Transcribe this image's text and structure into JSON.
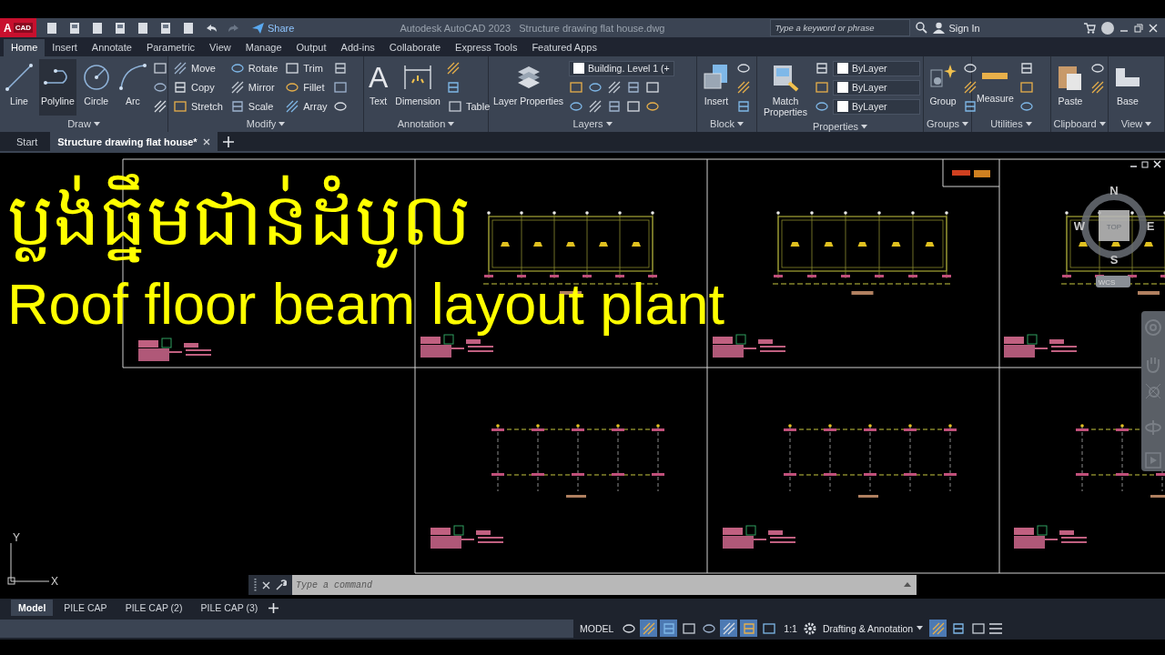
{
  "title_bar": {
    "logo_main": "A",
    "logo_sub": "CAD",
    "share": "Share",
    "app_title": "Autodesk AutoCAD 2023",
    "file_name": "Structure drawing flat house.dwg",
    "search_placeholder": "Type a keyword or phrase",
    "sign_in": "Sign In"
  },
  "ribbon_tabs": [
    {
      "label": "Home",
      "selected": true
    },
    {
      "label": "Insert",
      "selected": false
    },
    {
      "label": "Annotate",
      "selected": false
    },
    {
      "label": "Parametric",
      "selected": false
    },
    {
      "label": "View",
      "selected": false
    },
    {
      "label": "Manage",
      "selected": false
    },
    {
      "label": "Output",
      "selected": false
    },
    {
      "label": "Add-ins",
      "selected": false
    },
    {
      "label": "Collaborate",
      "selected": false
    },
    {
      "label": "Express Tools",
      "selected": false
    },
    {
      "label": "Featured Apps",
      "selected": false
    }
  ],
  "panels": [
    {
      "title": "Draw",
      "items": [
        {
          "kind": "large",
          "label": "Line",
          "highlighted": false
        },
        {
          "kind": "large",
          "label": "Polyline",
          "highlighted": true
        },
        {
          "kind": "large",
          "label": "Circle",
          "highlighted": false
        },
        {
          "kind": "large",
          "label": "Arc",
          "highlighted": false
        },
        {
          "kind": "icon"
        },
        {
          "kind": "icon"
        },
        {
          "kind": "icon"
        }
      ]
    },
    {
      "title": "Modify",
      "items": [
        {
          "kind": "small",
          "label": "Move"
        },
        {
          "kind": "small",
          "label": "Copy"
        },
        {
          "kind": "small",
          "label": "Stretch"
        },
        {
          "kind": "small",
          "label": "Rotate"
        },
        {
          "kind": "small",
          "label": "Mirror"
        },
        {
          "kind": "small",
          "label": "Scale"
        },
        {
          "kind": "small",
          "label": "Trim"
        },
        {
          "kind": "small",
          "label": "Fillet"
        },
        {
          "kind": "small",
          "label": "Array"
        },
        {
          "kind": "icon"
        },
        {
          "kind": "icon"
        },
        {
          "kind": "icon"
        }
      ]
    },
    {
      "title": "Annotation",
      "items": [
        {
          "kind": "large",
          "label": "Text",
          "glyph": "A",
          "highlighted": false
        },
        {
          "kind": "large",
          "label": "Dimension",
          "highlighted": false
        },
        {
          "kind": "icon"
        },
        {
          "kind": "icon"
        },
        {
          "kind": "small",
          "label": "Table"
        }
      ]
    },
    {
      "title": "Layers",
      "items": [
        {
          "kind": "large",
          "label": "Layer Properties",
          "highlighted": false
        },
        {
          "kind": "dropdown",
          "value": "Building. Level 1 (+"
        },
        {
          "kind": "icons"
        },
        {
          "kind": "icons"
        }
      ]
    },
    {
      "title": "Block",
      "items": [
        {
          "kind": "large",
          "label": "Insert",
          "highlighted": false
        },
        {
          "kind": "icon"
        },
        {
          "kind": "icon"
        },
        {
          "kind": "icon"
        }
      ]
    },
    {
      "title": "Properties",
      "items": [
        {
          "kind": "large",
          "label": "Match Properties",
          "highlighted": false
        },
        {
          "kind": "icon"
        },
        {
          "kind": "icon"
        },
        {
          "kind": "icon"
        },
        {
          "kind": "dropdown",
          "value": "ByLayer"
        },
        {
          "kind": "dropdown",
          "value": "ByLayer"
        },
        {
          "kind": "dropdown",
          "value": "ByLayer"
        }
      ]
    },
    {
      "title": "Groups",
      "items": [
        {
          "kind": "large",
          "label": "Group",
          "highlighted": false
        },
        {
          "kind": "icon"
        },
        {
          "kind": "icon"
        },
        {
          "kind": "icon"
        }
      ]
    },
    {
      "title": "Utilities",
      "items": [
        {
          "kind": "large",
          "label": "Measure",
          "highlighted": false
        },
        {
          "kind": "icon"
        },
        {
          "kind": "icon"
        },
        {
          "kind": "icon"
        }
      ]
    },
    {
      "title": "Clipboard",
      "items": [
        {
          "kind": "large",
          "label": "Paste",
          "highlighted": false
        },
        {
          "kind": "icon"
        },
        {
          "kind": "icon"
        }
      ]
    },
    {
      "title": "View",
      "items": [
        {
          "kind": "large",
          "label": "Base",
          "highlighted": false
        }
      ]
    }
  ],
  "doc_tabs": [
    {
      "label": "Start",
      "selected": false
    },
    {
      "label": "Structure drawing flat house*",
      "selected": true
    }
  ],
  "overlay": {
    "khmer_title": "ប្លង់ធ្នឹមជាន់ដំបូល",
    "english_title": "Roof floor beam layout plant"
  },
  "viewcube": {
    "north": "N",
    "west": "W",
    "east": "E",
    "south": "S",
    "face": "TOP",
    "ucs": "WCS"
  },
  "ucs_axes": {
    "y": "Y",
    "x": "X"
  },
  "command_line": {
    "placeholder": "Type a command"
  },
  "layout_tabs": [
    {
      "label": "Model",
      "selected": true
    },
    {
      "label": "PILE CAP",
      "selected": false
    },
    {
      "label": "PILE CAP (2)",
      "selected": false
    },
    {
      "label": "PILE CAP (3)",
      "selected": false
    }
  ],
  "status_bar": {
    "space": "MODEL",
    "scale": "1:1",
    "workspace": "Drafting & Annotation",
    "toggles": [
      {
        "on": false
      },
      {
        "on": true
      },
      {
        "on": true
      },
      {
        "on": false
      },
      {
        "on": false
      },
      {
        "on": true
      },
      {
        "on": true
      },
      {
        "on": false
      },
      {
        "on": true
      },
      {
        "on": false
      },
      {
        "on": false
      }
    ]
  }
}
